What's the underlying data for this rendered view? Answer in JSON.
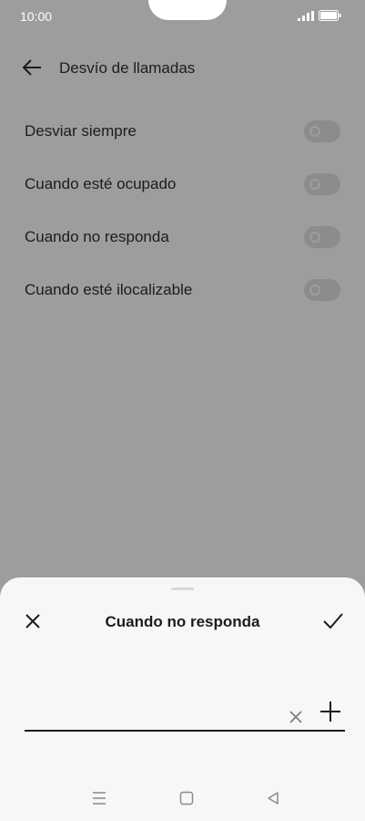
{
  "status_bar": {
    "time": "10:00",
    "signal_icon": "signal-icon",
    "battery_icon": "battery-icon"
  },
  "appbar": {
    "back_icon": "arrow-left-icon",
    "title": "Desvío de llamadas"
  },
  "forwarding_options": [
    {
      "label": "Desviar siempre",
      "enabled": false
    },
    {
      "label": "Cuando esté ocupado",
      "enabled": false
    },
    {
      "label": "Cuando no responda",
      "enabled": false
    },
    {
      "label": "Cuando esté ilocalizable",
      "enabled": false
    }
  ],
  "sheet": {
    "title": "Cuando no responda",
    "close_icon": "close-icon",
    "confirm_icon": "check-icon",
    "number_input": {
      "value": "",
      "placeholder": ""
    },
    "clear_icon": "clear-icon",
    "add_contact_icon": "plus-icon"
  },
  "nav_bar": {
    "icons": [
      "menu-icon",
      "home-square-icon",
      "back-triangle-icon"
    ]
  },
  "colors": {
    "dim_overlay": "#9d9d9d",
    "sheet_background": "#f7f7f7",
    "text_primary": "#1c1c1c",
    "toggle_off": "#8c8c8c"
  }
}
